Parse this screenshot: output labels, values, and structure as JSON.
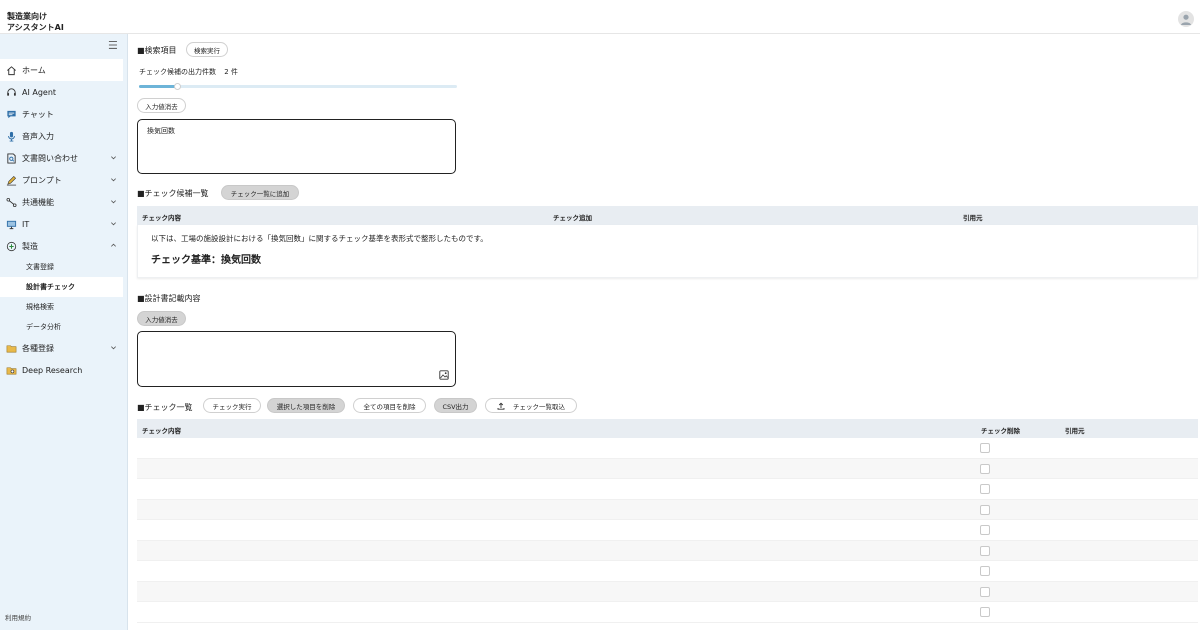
{
  "app": {
    "title_line1": "製造業向け",
    "title_line2": "アシスタントAI"
  },
  "sidebar": {
    "items": [
      {
        "label": "ホーム",
        "icon": "home-icon",
        "active": true
      },
      {
        "label": "AI Agent",
        "icon": "headset-icon"
      },
      {
        "label": "チャット",
        "icon": "chat-icon"
      },
      {
        "label": "音声入力",
        "icon": "microphone-icon"
      },
      {
        "label": "文書問い合わせ",
        "icon": "document-search-icon",
        "expandable": true
      },
      {
        "label": "プロンプト",
        "icon": "pen-icon",
        "expandable": true
      },
      {
        "label": "共通機能",
        "icon": "share-icon",
        "expandable": true
      },
      {
        "label": "IT",
        "icon": "monitor-icon",
        "expandable": true
      },
      {
        "label": "製造",
        "icon": "plus-circle-icon",
        "expanded": true
      }
    ],
    "sub_items": [
      "文書登録",
      "設計書チェック",
      "規格検索",
      "データ分析"
    ],
    "active_sub_item": "設計書チェック",
    "items_after": [
      {
        "label": "各種登録",
        "icon": "folder-icon",
        "expandable": true
      },
      {
        "label": "Deep Research",
        "icon": "folder-search-icon"
      }
    ],
    "footer_link": "利用規約"
  },
  "search": {
    "section_title": "■検索項目",
    "execute_button": "検索実行",
    "count_label": "チェック候補の出力件数",
    "count_value": "2 件",
    "slider_fraction": 0.12,
    "clear_button": "入力値消去",
    "query_text": "換気回数"
  },
  "candidates": {
    "section_title": "■チェック候補一覧",
    "add_button": "チェック一覧に追加",
    "columns": [
      "チェック内容",
      "チェック追加",
      "引用元"
    ],
    "intro_text": "以下は、工場の施設設計における「換気回数」に関するチェック基準を表形式で整形したものです。",
    "heading": "チェック基準：換気回数"
  },
  "design_doc": {
    "section_title": "■設計書記載内容",
    "clear_button": "入力値消去",
    "value": ""
  },
  "check_list": {
    "section_title": "■チェック一覧",
    "buttons": {
      "run": "チェック実行",
      "delete_selected": "選択した項目を削除",
      "delete_all": "全ての項目を削除",
      "csv": "CSV出力",
      "import": "チェック一覧取込"
    },
    "columns": [
      "チェック内容",
      "チェック削除",
      "引用元"
    ],
    "row_count": 9
  }
}
